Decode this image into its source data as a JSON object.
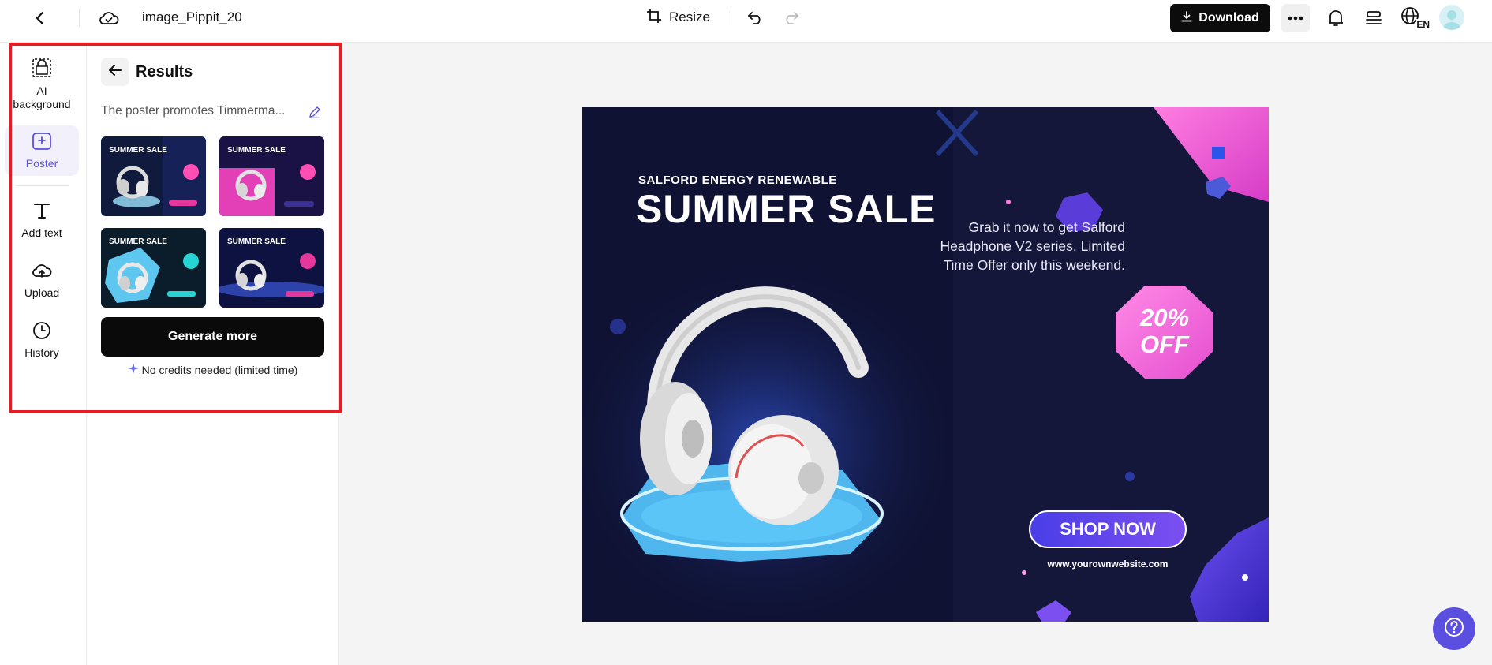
{
  "topbar": {
    "title": "image_Pippit_20",
    "resize_label": "Resize",
    "download_label": "Download",
    "lang_label": "EN"
  },
  "rail": {
    "items": [
      {
        "label": "AI background",
        "icon": "ai-background-icon"
      },
      {
        "label": "Poster",
        "icon": "poster-icon"
      },
      {
        "label": "Add text",
        "icon": "text-icon"
      },
      {
        "label": "Upload",
        "icon": "upload-icon"
      },
      {
        "label": "History",
        "icon": "history-icon"
      }
    ],
    "active": "Poster"
  },
  "panel": {
    "title": "Results",
    "prompt": "The poster promotes Timmerma...",
    "thumb_text": "SUMMER SALE",
    "generate_label": "Generate more",
    "credits_text": "No credits needed (limited time)"
  },
  "poster": {
    "subtitle": "SALFORD ENERGY RENEWABLE",
    "title": "SUMMER SALE",
    "description": "Grab it now to get Salford Headphone V2 series. Limited Time Offer only this weekend.",
    "badge_line1": "20%",
    "badge_line2": "OFF",
    "cta": "SHOP NOW",
    "url": "www.yourownwebsite.com"
  },
  "colors": {
    "accent": "#5b4fe0",
    "highlight": "#e01e24",
    "download_bg": "#0c0c0c"
  }
}
